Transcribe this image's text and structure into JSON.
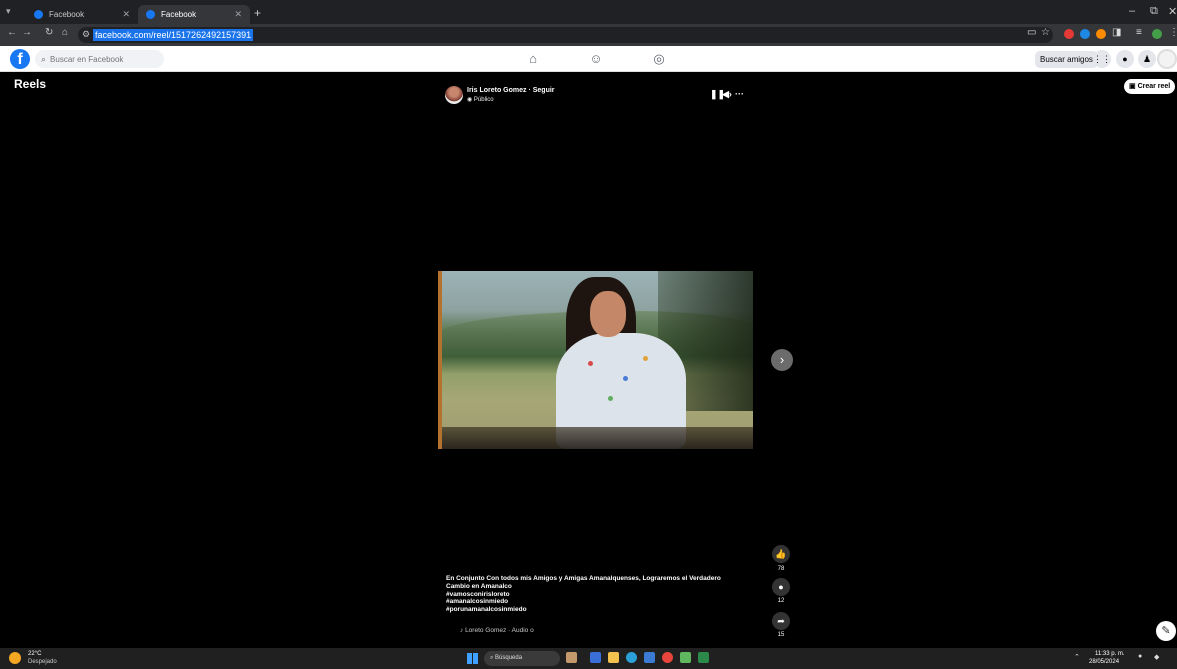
{
  "browser": {
    "tabs": [
      {
        "title": "Facebook",
        "active": false
      },
      {
        "title": "Facebook",
        "active": true
      }
    ],
    "new_tab": "+",
    "url": "facebook.com/reel/1517262492157391",
    "window_controls": {
      "minimize": "–",
      "maximize": "⧉",
      "close": "✕"
    }
  },
  "facebook": {
    "search_placeholder": "Buscar en Facebook",
    "find_friends": "Buscar amigos"
  },
  "reels": {
    "title": "Reels",
    "create_button": "Crear reel",
    "author": "Iris Loreto Gomez",
    "follow": "Seguir",
    "author_line": "Iris Loreto Gomez · Seguir",
    "privacy": "Público",
    "caption": [
      "En Conjunto Con todos mis Amigos y Amigas Amanalquenses, Lograremos el Verdadero",
      "Cambio en Amanalco",
      "#vamosconirisloreto",
      "#amanalcosinmiedo",
      "#porunamanalcosinmiedo"
    ],
    "audio": "Loreto Gomez · Audio o",
    "likes": "78",
    "comments": "12",
    "shares": "15"
  },
  "taskbar": {
    "weather_temp": "22°C",
    "weather_desc": "Despejado",
    "search_label": "Búsqueda",
    "time": "11:33 p. m.",
    "date": "28/05/2024"
  },
  "colors": {
    "facebook_blue": "#1877f2",
    "browser_dark": "#202124",
    "url_highlight": "#1a73e8"
  }
}
